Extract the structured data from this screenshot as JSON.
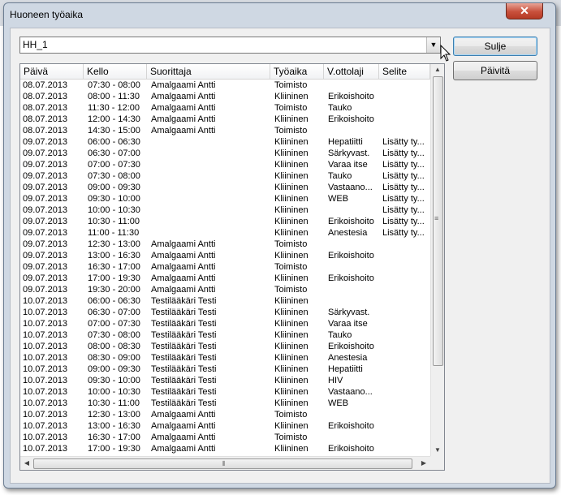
{
  "window": {
    "title": "Huoneen työaika",
    "close_glyph": "✕"
  },
  "combo": {
    "value": "HH_1",
    "arrow": "▼"
  },
  "buttons": {
    "close_label": "Sulje",
    "refresh_label": "Päivitä"
  },
  "columns": [
    "Päivä",
    "Kello",
    "Suorittaja",
    "Työaika",
    "V.ottolaji",
    "Selite"
  ],
  "rows": [
    [
      "08.07.2013",
      "07:30 - 08:00",
      "Amalgaami Antti",
      "Toimisto",
      "",
      ""
    ],
    [
      "08.07.2013",
      "08:00 - 11:30",
      "Amalgaami Antti",
      "Kliininen",
      "Erikoishoito",
      ""
    ],
    [
      "08.07.2013",
      "11:30 - 12:00",
      "Amalgaami Antti",
      "Toimisto",
      "Tauko",
      ""
    ],
    [
      "08.07.2013",
      "12:00 - 14:30",
      "Amalgaami Antti",
      "Kliininen",
      "Erikoishoito",
      ""
    ],
    [
      "08.07.2013",
      "14:30 - 15:00",
      "Amalgaami Antti",
      "Toimisto",
      "",
      ""
    ],
    [
      "09.07.2013",
      "06:00 - 06:30",
      "",
      "Kliininen",
      "Hepatiitti",
      "Lisätty ty..."
    ],
    [
      "09.07.2013",
      "06:30 - 07:00",
      "",
      "Kliininen",
      "Särkyvast.",
      "Lisätty ty..."
    ],
    [
      "09.07.2013",
      "07:00 - 07:30",
      "",
      "Kliininen",
      "Varaa itse",
      "Lisätty ty..."
    ],
    [
      "09.07.2013",
      "07:30 - 08:00",
      "",
      "Kliininen",
      "Tauko",
      "Lisätty ty..."
    ],
    [
      "09.07.2013",
      "09:00 - 09:30",
      "",
      "Kliininen",
      "Vastaano...",
      "Lisätty ty..."
    ],
    [
      "09.07.2013",
      "09:30 - 10:00",
      "",
      "Kliininen",
      "WEB",
      "Lisätty ty..."
    ],
    [
      "09.07.2013",
      "10:00 - 10:30",
      "",
      "Kliininen",
      "",
      "Lisätty ty..."
    ],
    [
      "09.07.2013",
      "10:30 - 11:00",
      "",
      "Kliininen",
      "Erikoishoito",
      "Lisätty ty..."
    ],
    [
      "09.07.2013",
      "11:00 - 11:30",
      "",
      "Kliininen",
      "Anestesia",
      "Lisätty ty..."
    ],
    [
      "09.07.2013",
      "12:30 - 13:00",
      "Amalgaami Antti",
      "Toimisto",
      "",
      ""
    ],
    [
      "09.07.2013",
      "13:00 - 16:30",
      "Amalgaami Antti",
      "Kliininen",
      "Erikoishoito",
      ""
    ],
    [
      "09.07.2013",
      "16:30 - 17:00",
      "Amalgaami Antti",
      "Toimisto",
      "",
      ""
    ],
    [
      "09.07.2013",
      "17:00 - 19:30",
      "Amalgaami Antti",
      "Kliininen",
      "Erikoishoito",
      ""
    ],
    [
      "09.07.2013",
      "19:30 - 20:00",
      "Amalgaami Antti",
      "Toimisto",
      "",
      ""
    ],
    [
      "10.07.2013",
      "06:00 - 06:30",
      "Testilääkäri Testi",
      "Kliininen",
      "",
      ""
    ],
    [
      "10.07.2013",
      "06:30 - 07:00",
      "Testilääkäri Testi",
      "Kliininen",
      "Särkyvast.",
      ""
    ],
    [
      "10.07.2013",
      "07:00 - 07:30",
      "Testilääkäri Testi",
      "Kliininen",
      "Varaa itse",
      ""
    ],
    [
      "10.07.2013",
      "07:30 - 08:00",
      "Testilääkäri Testi",
      "Kliininen",
      "Tauko",
      ""
    ],
    [
      "10.07.2013",
      "08:00 - 08:30",
      "Testilääkäri Testi",
      "Kliininen",
      "Erikoishoito",
      ""
    ],
    [
      "10.07.2013",
      "08:30 - 09:00",
      "Testilääkäri Testi",
      "Kliininen",
      "Anestesia",
      ""
    ],
    [
      "10.07.2013",
      "09:00 - 09:30",
      "Testilääkäri Testi",
      "Kliininen",
      "Hepatiitti",
      ""
    ],
    [
      "10.07.2013",
      "09:30 - 10:00",
      "Testilääkäri Testi",
      "Kliininen",
      "HIV",
      ""
    ],
    [
      "10.07.2013",
      "10:00 - 10:30",
      "Testilääkäri Testi",
      "Kliininen",
      "Vastaano...",
      ""
    ],
    [
      "10.07.2013",
      "10:30 - 11:00",
      "Testilääkäri Testi",
      "Kliininen",
      "WEB",
      ""
    ],
    [
      "10.07.2013",
      "12:30 - 13:00",
      "Amalgaami Antti",
      "Toimisto",
      "",
      ""
    ],
    [
      "10.07.2013",
      "13:00 - 16:30",
      "Amalgaami Antti",
      "Kliininen",
      "Erikoishoito",
      ""
    ],
    [
      "10.07.2013",
      "16:30 - 17:00",
      "Amalgaami Antti",
      "Toimisto",
      "",
      ""
    ],
    [
      "10.07.2013",
      "17:00 - 19:30",
      "Amalgaami Antti",
      "Kliininen",
      "Erikoishoito",
      ""
    ]
  ],
  "scroll": {
    "up": "▲",
    "down": "▼",
    "left": "◀",
    "right": "▶",
    "grip_v": "≡",
    "grip_h": "⦀"
  }
}
